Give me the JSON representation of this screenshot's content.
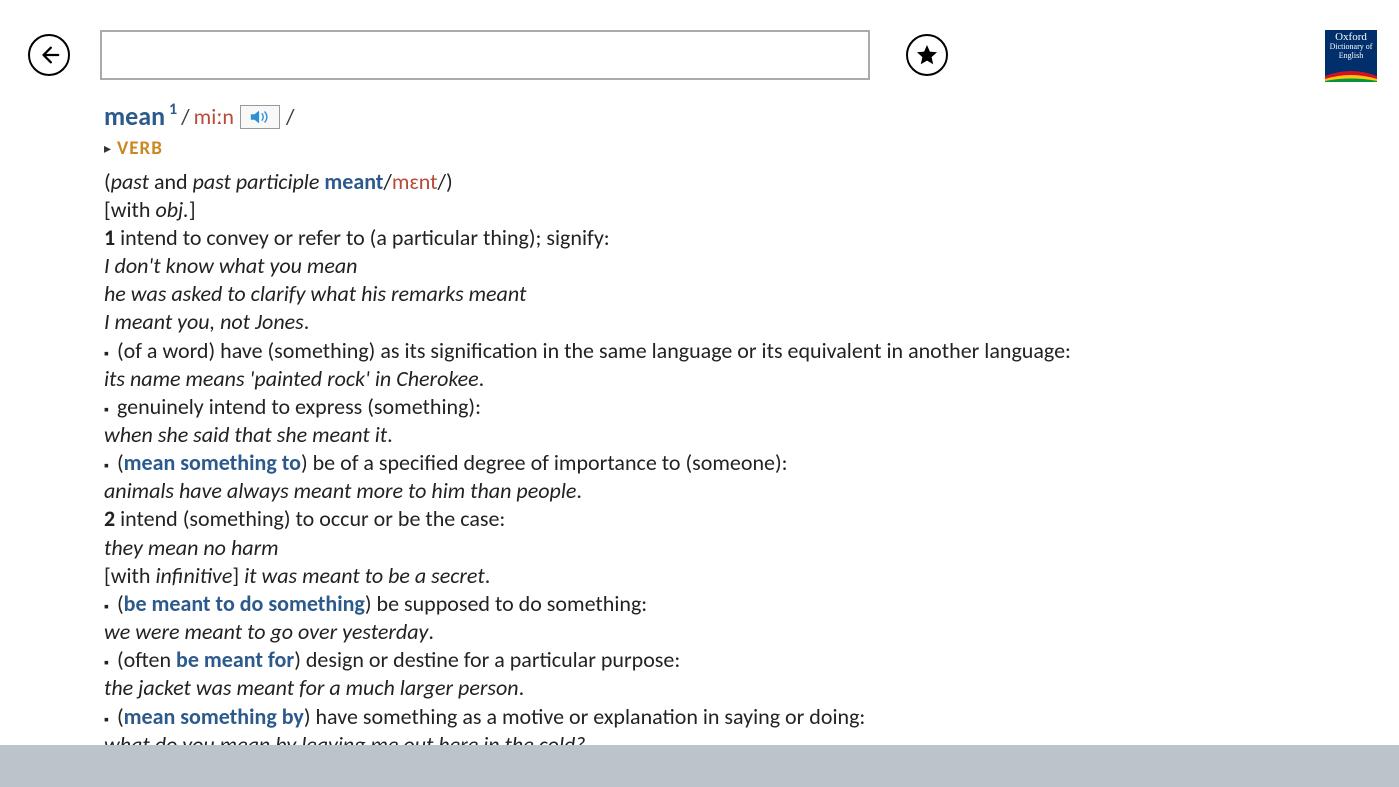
{
  "logo": {
    "l1": "Oxford",
    "l2": "Dictionary of",
    "l3": "English"
  },
  "search": {
    "value": ""
  },
  "entry": {
    "headword": "mean",
    "homnum": "1",
    "pron": "miːn",
    "pos": "VERB",
    "inflect_pre": "(",
    "inflect_past": "past",
    "inflect_and": " and ",
    "inflect_pp": "past participle",
    "inflect_word": "meant",
    "inflect_pron": "mɛnt",
    "inflect_post": ")",
    "gram_open": "[with ",
    "gram_obj": "obj.",
    "gram_close": "]",
    "s1_num": "1",
    "s1_def": " intend to convey or refer to (a particular thing); signify:",
    "s1_ex1": "I don't know what you mean",
    "s1_ex2": "he was asked to clarify what his remarks meant",
    "s1_ex3": "I meant you, not Jones",
    "s1_ex3_end": ".",
    "s1b_def": "(of a word) have (something) as its signification in the same language or its equivalent in another language:",
    "s1b_ex": "its name means 'painted rock' in Cherokee",
    "s1b_ex_end": ".",
    "s1c_def": "genuinely intend to express (something):",
    "s1c_ex": "when she said that she meant it",
    "s1c_ex_end": ".",
    "s1d_phrase": "mean something to",
    "s1d_def": ") be of a specified degree of importance to (someone):",
    "s1d_ex": "animals have always meant more to him than people",
    "s1d_ex_end": ".",
    "s2_num": "2",
    "s2_def": " intend (something) to occur or be the case:",
    "s2_ex1": "they mean no harm",
    "s2_gram_open": "[with ",
    "s2_inf": "infinitive",
    "s2_gram_close": "] ",
    "s2_ex2": "it was meant to be a secret",
    "s2_ex2_end": ".",
    "s2b_phrase": "be meant to do something",
    "s2b_def": ") be supposed to do something:",
    "s2b_ex": "we were meant to go over yesterday",
    "s2b_ex_end": ".",
    "s2c_often": "(often ",
    "s2c_phrase": "be meant for",
    "s2c_def": ") design or destine for a particular purpose:",
    "s2c_ex": "the jacket was meant for a much larger person",
    "s2c_ex_end": ".",
    "s2d_phrase": "mean something by",
    "s2d_def": ") have something as a motive or explanation in saying or doing:",
    "s2d_ex": "what do you mean by leaving me out here in the cold?"
  }
}
